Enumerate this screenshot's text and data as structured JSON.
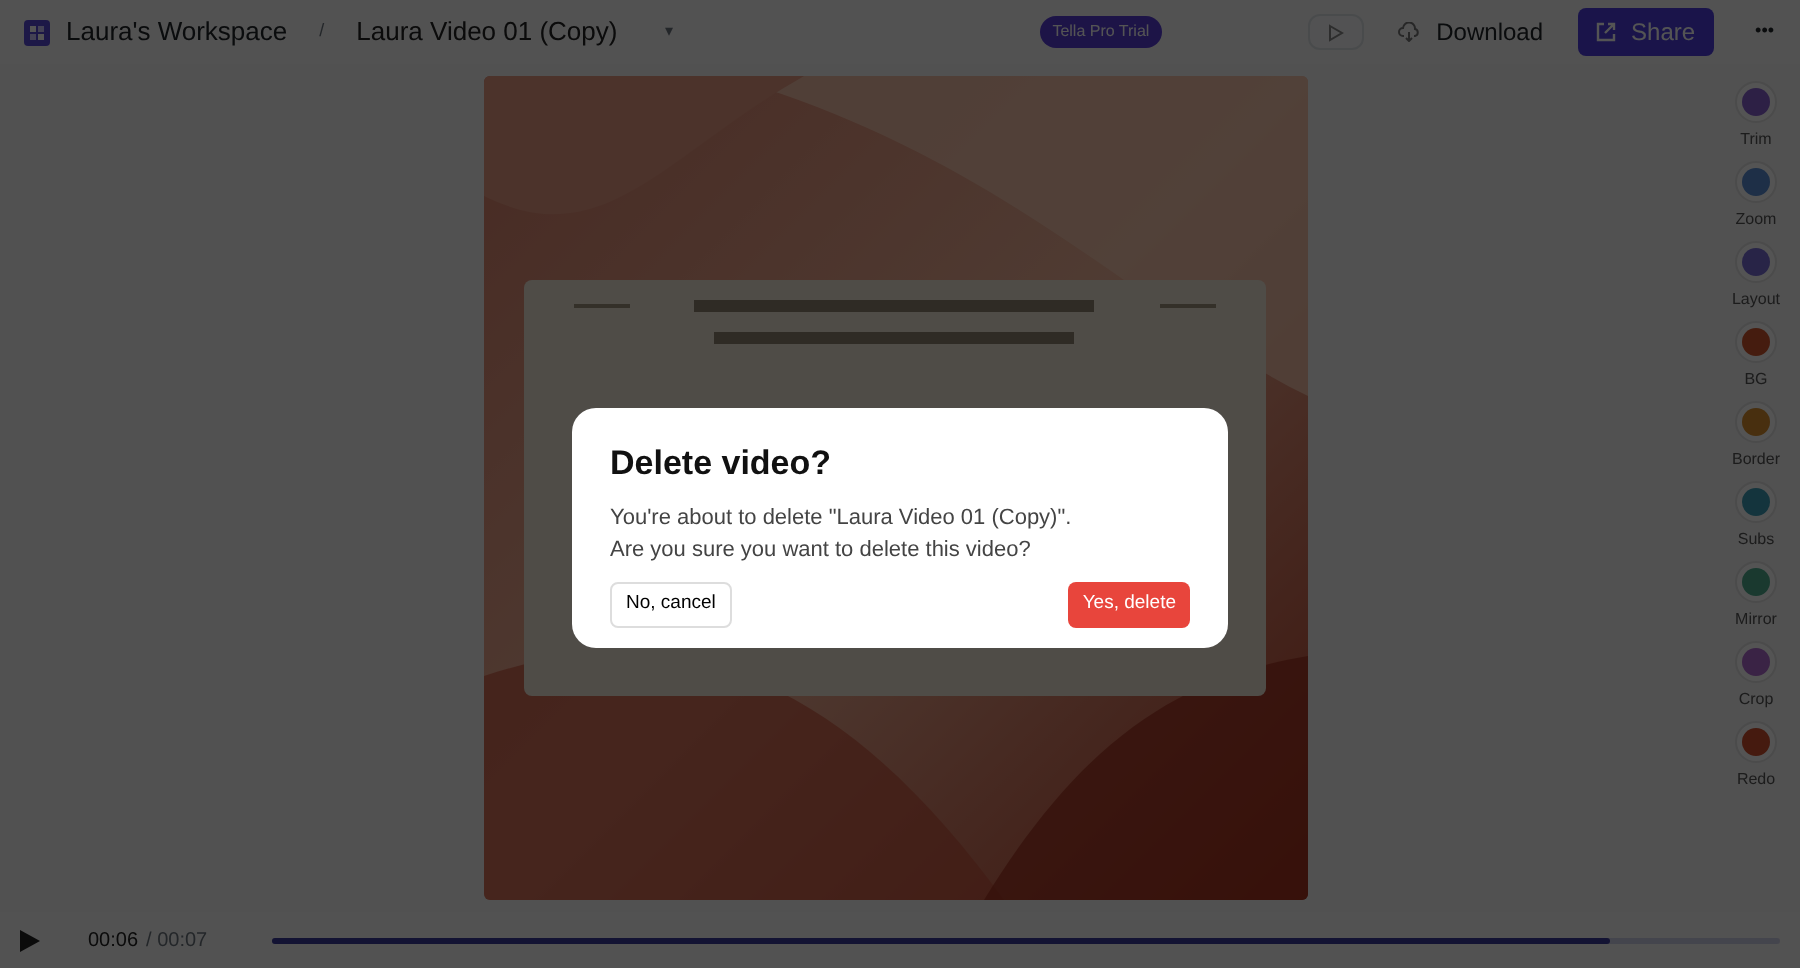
{
  "topbar": {
    "workspace": "Laura's Workspace",
    "separator": "/",
    "video_title": "Laura Video 01 (Copy)",
    "caret": "▾",
    "badge": "Tella Pro Trial",
    "download": "Download",
    "share": "Share",
    "more": "•••"
  },
  "tools": [
    {
      "label": "Trim"
    },
    {
      "label": "Zoom"
    },
    {
      "label": "Layout"
    },
    {
      "label": "BG"
    },
    {
      "label": "Border"
    },
    {
      "label": "Subs"
    },
    {
      "label": "Mirror"
    },
    {
      "label": "Crop"
    },
    {
      "label": "Redo"
    }
  ],
  "player": {
    "current": "00:06",
    "total": "/ 00:07",
    "level": 0.887
  },
  "dialog": {
    "title": "Delete video?",
    "message": "You're about to delete \"Laura Video 01 (Copy)\".\nAre you sure you want to delete this video?",
    "cancel": "No, cancel",
    "confirm": "Yes, delete"
  }
}
